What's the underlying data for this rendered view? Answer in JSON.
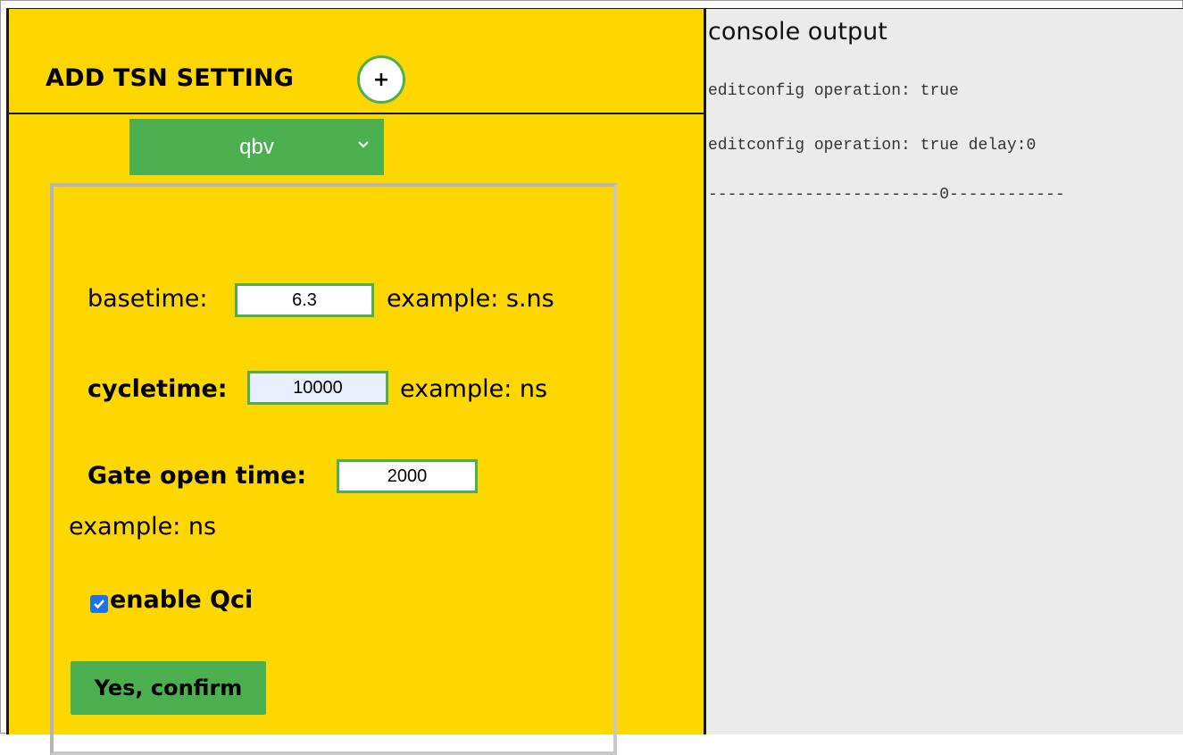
{
  "tsn_panel": {
    "title": "ADD TSN SETTING",
    "add_button_label": "+",
    "selected_type": "qbv",
    "fields": {
      "basetime": {
        "label": "basetime:",
        "value": "6.3",
        "hint": "example: s.ns"
      },
      "cycletime": {
        "label": "cycletime:",
        "value": "10000",
        "hint": "example: ns"
      },
      "gate_open_time": {
        "label": "Gate open time:",
        "value": "2000",
        "hint": "example: ns"
      }
    },
    "enable_qci": {
      "label": "enable Qci",
      "checked": true
    },
    "confirm_button_label": "Yes, confirm"
  },
  "console": {
    "title": "console output",
    "lines": [
      "editconfig operation: true",
      "editconfig operation: true delay:0",
      "------------------------0------------"
    ]
  },
  "colors": {
    "panel_background": "#ffd700",
    "accent_green": "#4caf50",
    "console_background": "#ebebeb",
    "checkbox_blue": "#1a73e8"
  }
}
